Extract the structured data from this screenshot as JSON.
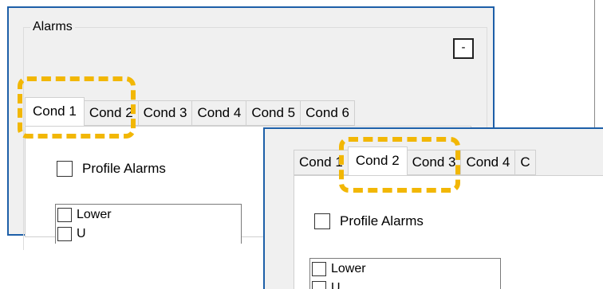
{
  "panel1": {
    "group_title": "Alarms",
    "collapse_label": "-",
    "tabs": [
      {
        "label": "Cond 1",
        "active": true
      },
      {
        "label": "Cond 2",
        "active": false
      },
      {
        "label": "Cond 3",
        "active": false
      },
      {
        "label": "Cond 4",
        "active": false
      },
      {
        "label": "Cond 5",
        "active": false
      },
      {
        "label": "Cond 6",
        "active": false
      }
    ],
    "profile_alarms_label": "Profile Alarms",
    "list_items": [
      {
        "label": "Lower"
      },
      {
        "label": "U"
      }
    ]
  },
  "panel2": {
    "tabs": [
      {
        "label": "Cond 1",
        "active": false
      },
      {
        "label": "Cond 2",
        "active": true
      },
      {
        "label": "Cond 3",
        "active": false
      },
      {
        "label": "Cond 4",
        "active": false
      },
      {
        "label": "C",
        "active": false
      }
    ],
    "profile_alarms_label": "Profile Alarms",
    "list_items": [
      {
        "label": "Lower"
      },
      {
        "label": "U"
      }
    ]
  },
  "colors": {
    "panel_border": "#1d5fa8",
    "highlight": "#f2b705",
    "panel_background": "#f0f0f0"
  }
}
